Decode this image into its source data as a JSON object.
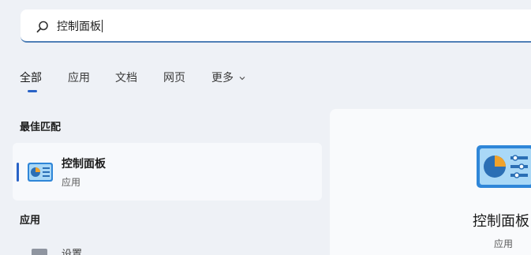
{
  "search": {
    "value": "控制面板"
  },
  "tabs": [
    {
      "label": "全部"
    },
    {
      "label": "应用"
    },
    {
      "label": "文档"
    },
    {
      "label": "网页"
    },
    {
      "label": "更多"
    }
  ],
  "best_match": {
    "heading": "最佳匹配",
    "title": "控制面板",
    "subtitle": "应用"
  },
  "apps_section": {
    "heading": "应用",
    "first_item": "设置"
  },
  "preview": {
    "title": "控制面板",
    "subtitle": "应用"
  },
  "colors": {
    "accent": "#2a63c7",
    "background": "#eef1f6"
  },
  "icons": [
    "search-icon",
    "control-panel-icon",
    "chevron-down-icon",
    "settings-icon"
  ]
}
